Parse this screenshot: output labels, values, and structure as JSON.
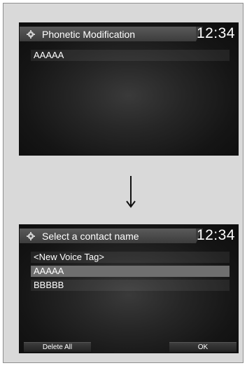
{
  "screen1": {
    "title": "Phonetic Modification",
    "clock": "12:34",
    "items": [
      "AAAAA"
    ]
  },
  "screen2": {
    "title": "Select a contact name",
    "clock": "12:34",
    "items": [
      "<New Voice Tag>",
      "AAAAA",
      "BBBBB"
    ],
    "selected_index": 1,
    "softkeys": {
      "left": "Delete All",
      "right": "OK"
    }
  },
  "icons": {
    "settings": "gear-icon",
    "transition": "arrow-down-icon"
  }
}
